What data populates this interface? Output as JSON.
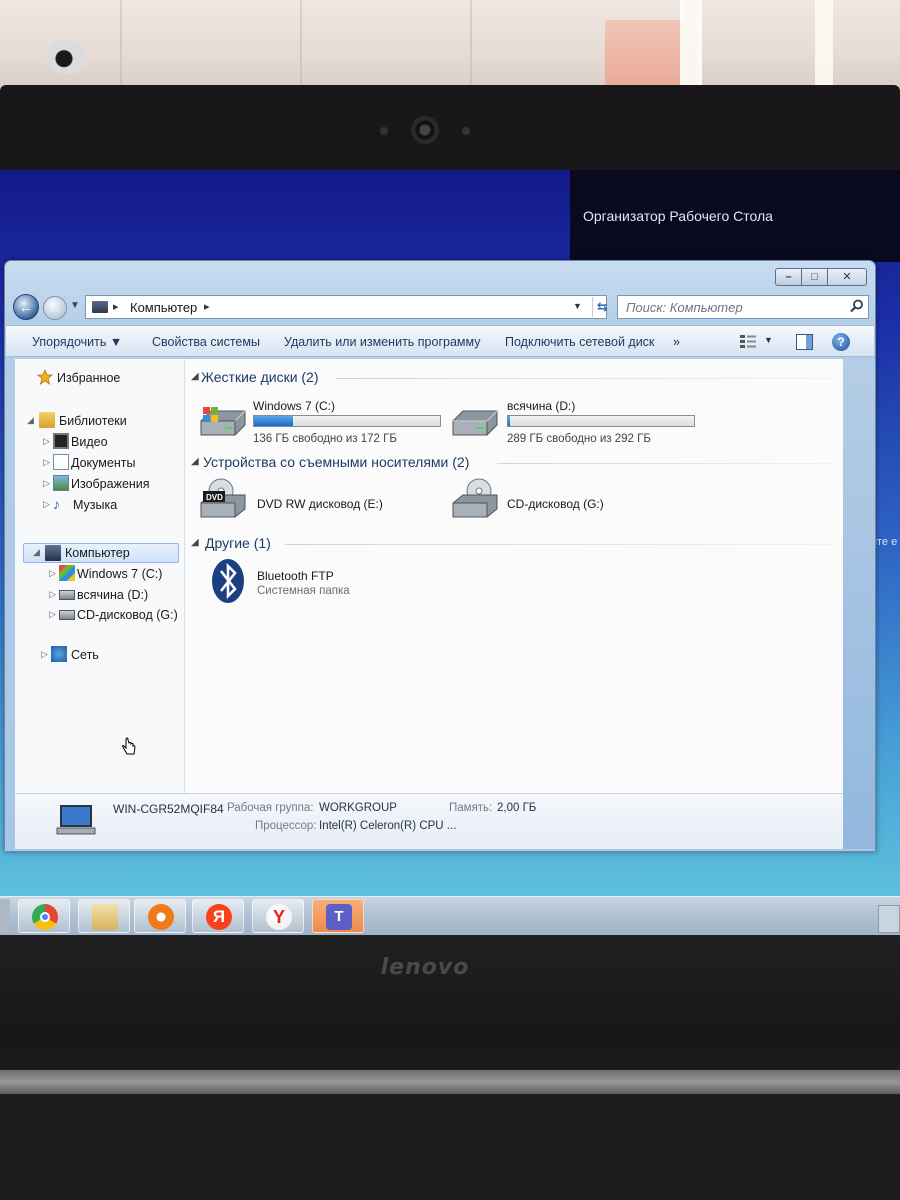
{
  "gadget": {
    "title": "Организатор Рабочего Стола",
    "clock_fragment": ""
  },
  "desktop_edge_text": "длите е",
  "window": {
    "address": {
      "root_label": "Компьютер"
    },
    "search": {
      "placeholder": "Поиск: Компьютер"
    },
    "caption_buttons": {
      "minimize": "–",
      "maximize": "□",
      "close": "✕"
    },
    "toolbar": {
      "organize": "Упорядочить ▼",
      "system_properties": "Свойства системы",
      "uninstall": "Удалить или изменить программу",
      "map_drive": "Подключить сетевой диск",
      "more": "»"
    },
    "sidebar": {
      "favorites": "Избранное",
      "libraries": "Библиотеки",
      "library_items": [
        "Видео",
        "Документы",
        "Изображения",
        "Музыка"
      ],
      "computer": "Компьютер",
      "computer_items": [
        "Windows 7 (C:)",
        "всячина (D:)",
        "CD-дисковод (G:)"
      ],
      "network": "Сеть"
    },
    "groups": {
      "hard_drives": "Жесткие диски (2)",
      "removable": "Устройства со съемными носителями (2)",
      "other": "Другие (1)"
    },
    "drives": [
      {
        "name": "Windows 7 (C:)",
        "free_text": "136 ГБ свободно из 172 ГБ",
        "used_fraction": 0.21
      },
      {
        "name": "всячина (D:)",
        "free_text": "289 ГБ свободно из 292 ГБ",
        "used_fraction": 0.01
      }
    ],
    "removable_devices": [
      {
        "name": "DVD RW дисковод (E:)",
        "badge": "DVD"
      },
      {
        "name": "CD-дисковод (G:)"
      }
    ],
    "other_items": [
      {
        "name": "Bluetooth FTP",
        "type": "Системная папка"
      }
    ],
    "details": {
      "computer_name": "WIN-CGR52MQIF84",
      "workgroup_label": "Рабочая группа:",
      "workgroup_value": "WORKGROUP",
      "memory_label": "Память:",
      "memory_value": "2,00 ГБ",
      "cpu_label": "Процессор:",
      "cpu_value": "Intel(R) Celeron(R) CPU ..."
    }
  },
  "taskbar": {
    "apps": [
      "chrome-icon",
      "file-explorer-icon",
      "media-player-icon",
      "yandex-icon",
      "yandex-browser-icon",
      "teams-icon"
    ]
  },
  "laptop": {
    "brand": "lenovo"
  },
  "colors": {
    "accent": "#1e66c8",
    "window_frame": "#a8c6e6",
    "desktop": "#2f67c4"
  }
}
